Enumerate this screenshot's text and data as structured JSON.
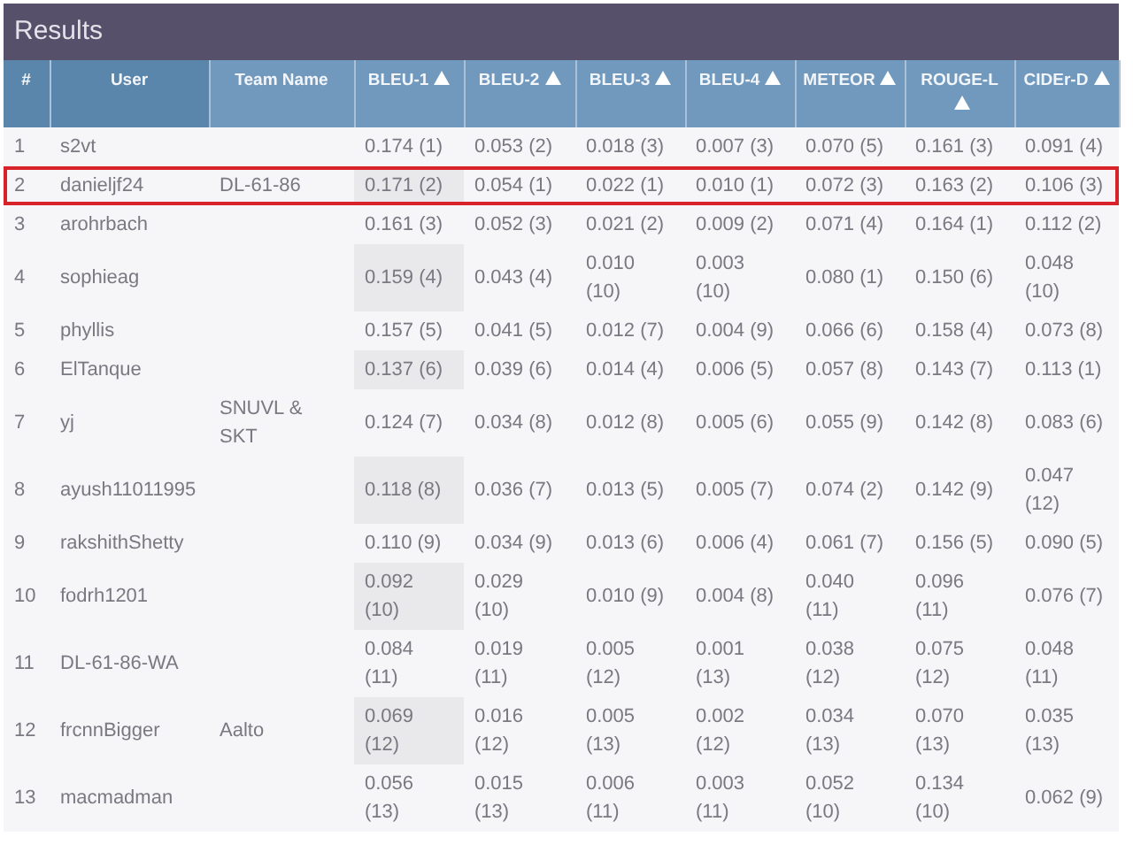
{
  "panel": {
    "title": "Results"
  },
  "columns": [
    {
      "label": "#",
      "sortable": false,
      "dark": true,
      "sorted": false
    },
    {
      "label": "User",
      "sortable": false,
      "dark": true,
      "sorted": false
    },
    {
      "label": "Team Name",
      "sortable": false,
      "dark": false,
      "sorted": false
    },
    {
      "label": "BLEU-1",
      "sortable": true,
      "dark": false,
      "sorted": true
    },
    {
      "label": "BLEU-2",
      "sortable": true,
      "dark": false,
      "sorted": false
    },
    {
      "label": "BLEU-3",
      "sortable": true,
      "dark": false,
      "sorted": false
    },
    {
      "label": "BLEU-4",
      "sortable": true,
      "dark": false,
      "sorted": false
    },
    {
      "label": "METEOR",
      "sortable": true,
      "dark": false,
      "sorted": false
    },
    {
      "label": "ROUGE-L",
      "sortable": true,
      "dark": false,
      "sorted": false
    },
    {
      "label": "CIDEr-D",
      "sortable": true,
      "dark": false,
      "sorted": false
    }
  ],
  "rows": [
    {
      "highlighted": false,
      "cells": [
        "1",
        "s2vt",
        "",
        "0.174 (1)",
        "0.053 (2)",
        "0.018 (3)",
        "0.007 (3)",
        "0.070 (5)",
        "0.161 (3)",
        "0.091 (4)"
      ]
    },
    {
      "highlighted": true,
      "cells": [
        "2",
        "danieljf24",
        "DL-61-86",
        "0.171 (2)",
        "0.054 (1)",
        "0.022 (1)",
        "0.010 (1)",
        "0.072 (3)",
        "0.163 (2)",
        "0.106 (3)"
      ]
    },
    {
      "highlighted": false,
      "cells": [
        "3",
        "arohrbach",
        "",
        "0.161 (3)",
        "0.052 (3)",
        "0.021 (2)",
        "0.009 (2)",
        "0.071 (4)",
        "0.164 (1)",
        "0.112 (2)"
      ]
    },
    {
      "highlighted": false,
      "cells": [
        "4",
        "sophieag",
        "",
        "0.159 (4)",
        "0.043 (4)",
        "0.010 (10)",
        "0.003 (10)",
        "0.080 (1)",
        "0.150 (6)",
        "0.048 (10)"
      ]
    },
    {
      "highlighted": false,
      "cells": [
        "5",
        "phyllis",
        "",
        "0.157 (5)",
        "0.041 (5)",
        "0.012 (7)",
        "0.004 (9)",
        "0.066 (6)",
        "0.158 (4)",
        "0.073 (8)"
      ]
    },
    {
      "highlighted": false,
      "cells": [
        "6",
        "ElTanque",
        "",
        "0.137 (6)",
        "0.039 (6)",
        "0.014 (4)",
        "0.006 (5)",
        "0.057 (8)",
        "0.143 (7)",
        "0.113 (1)"
      ]
    },
    {
      "highlighted": false,
      "cells": [
        "7",
        "yj",
        "SNUVL & SKT",
        "0.124 (7)",
        "0.034 (8)",
        "0.012 (8)",
        "0.005 (6)",
        "0.055 (9)",
        "0.142 (8)",
        "0.083 (6)"
      ]
    },
    {
      "highlighted": false,
      "cells": [
        "8",
        "ayush11011995",
        "",
        "0.118 (8)",
        "0.036 (7)",
        "0.013 (5)",
        "0.005 (7)",
        "0.074 (2)",
        "0.142 (9)",
        "0.047 (12)"
      ]
    },
    {
      "highlighted": false,
      "cells": [
        "9",
        "rakshithShetty",
        "",
        "0.110 (9)",
        "0.034 (9)",
        "0.013 (6)",
        "0.006 (4)",
        "0.061 (7)",
        "0.156 (5)",
        "0.090 (5)"
      ]
    },
    {
      "highlighted": false,
      "cells": [
        "10",
        "fodrh1201",
        "",
        "0.092 (10)",
        "0.029 (10)",
        "0.010 (9)",
        "0.004 (8)",
        "0.040 (11)",
        "0.096 (11)",
        "0.076 (7)"
      ]
    },
    {
      "highlighted": false,
      "cells": [
        "11",
        "DL-61-86-WA",
        "",
        "0.084 (11)",
        "0.019 (11)",
        "0.005 (12)",
        "0.001 (13)",
        "0.038 (12)",
        "0.075 (12)",
        "0.048 (11)"
      ]
    },
    {
      "highlighted": false,
      "cells": [
        "12",
        "frcnnBigger",
        "Aalto",
        "0.069 (12)",
        "0.016 (12)",
        "0.005 (13)",
        "0.002 (12)",
        "0.034 (13)",
        "0.070 (13)",
        "0.035 (13)"
      ]
    },
    {
      "highlighted": false,
      "cells": [
        "13",
        "macmadman",
        "",
        "0.056 (13)",
        "0.015 (13)",
        "0.006 (11)",
        "0.003 (11)",
        "0.052 (10)",
        "0.134 (10)",
        "0.062 (9)"
      ]
    }
  ]
}
